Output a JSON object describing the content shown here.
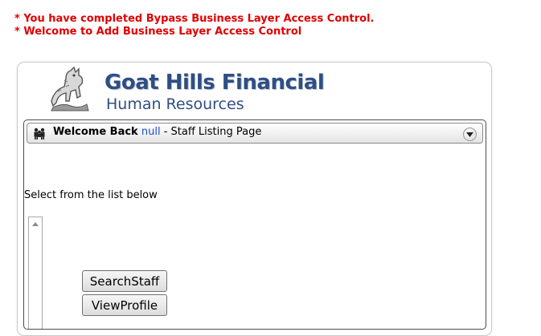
{
  "messages": [
    "* You have completed Bypass Business Layer Access Control.",
    "* Welcome to Add Business Layer Access Control"
  ],
  "logo": {
    "title": "Goat Hills Financial",
    "subtitle": "Human Resources"
  },
  "header": {
    "welcome": "Welcome Back",
    "user": "null",
    "page": " - Staff Listing Page"
  },
  "main": {
    "select_label": "Select from the list below",
    "buttons": {
      "search_staff": "SearchStaff",
      "view_profile": "ViewProfile"
    }
  },
  "colors": {
    "message": "#e00000",
    "brand": "#2f4e83",
    "user_link": "#1a4fc7"
  },
  "icons": [
    "goat-logo-icon",
    "people-icon",
    "collapse-icon",
    "scroll-up-icon"
  ]
}
